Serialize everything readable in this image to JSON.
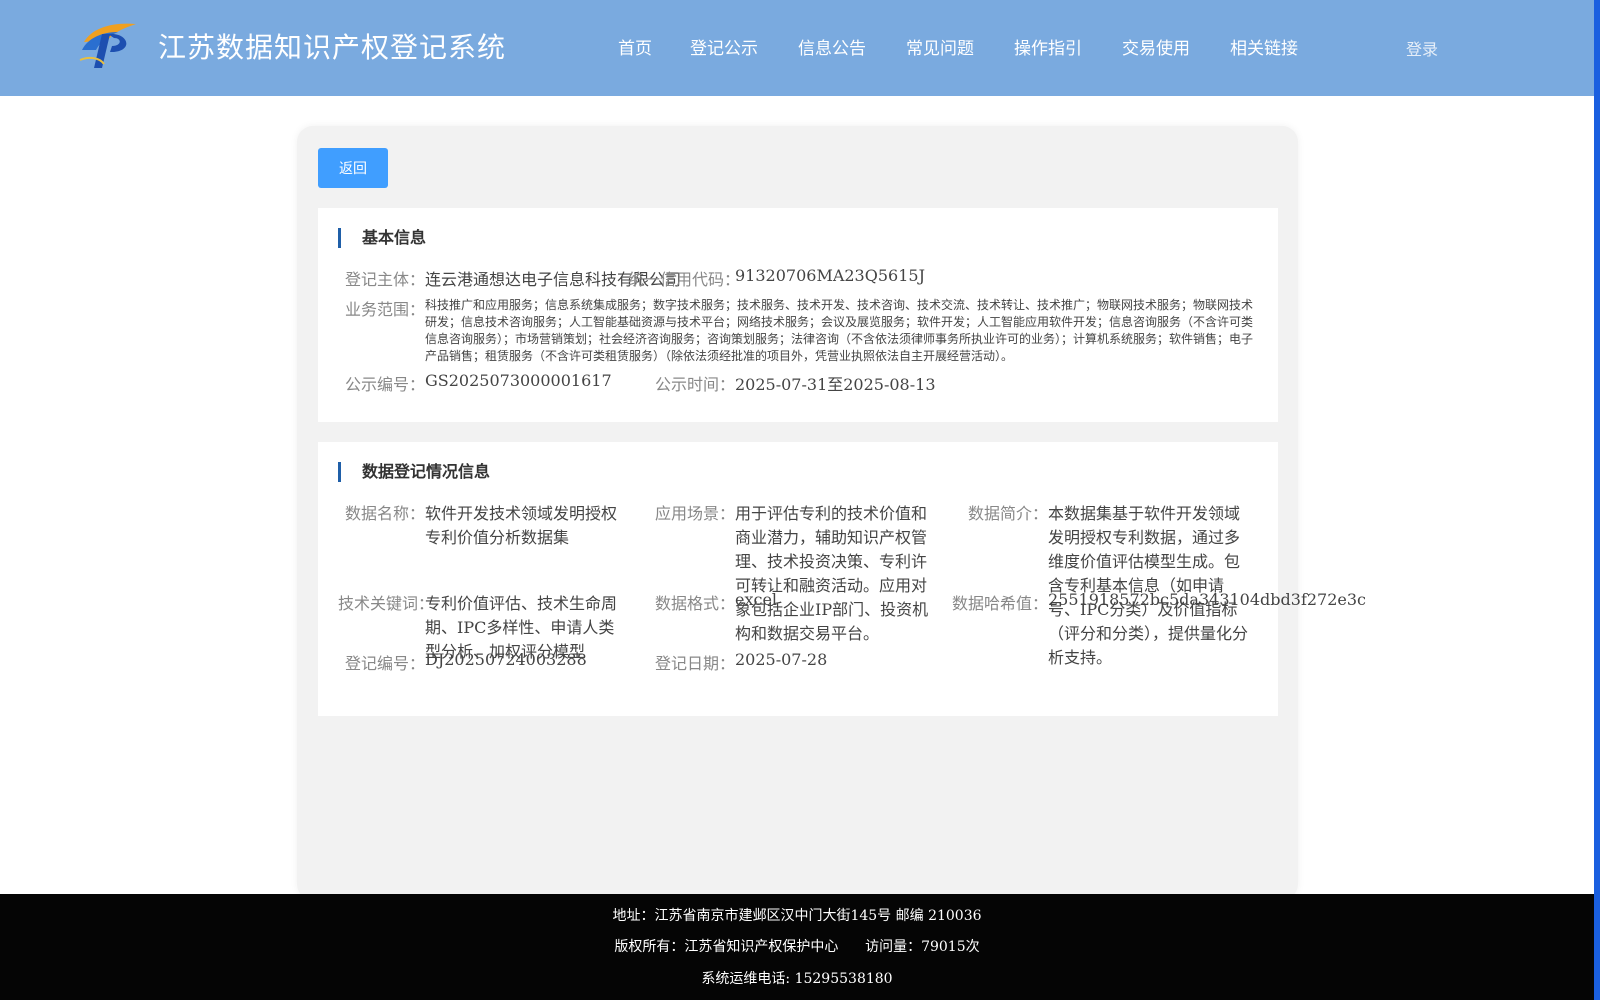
{
  "header": {
    "title": "江苏数据知识产权登记系统",
    "nav": [
      "首页",
      "登记公示",
      "信息公告",
      "常见问题",
      "操作指引",
      "交易使用",
      "相关链接"
    ],
    "login": "登录",
    "logo_icon": "ip-logo-icon",
    "bg_color": "#7aaadf"
  },
  "card": {
    "back_label": "返回",
    "basic": {
      "title": "基本信息",
      "subject_label": "登记主体：",
      "subject_value": "连云港通想达电子信息科技有限公司",
      "credit_label": "统一信用代码：",
      "credit_value": "91320706MA23Q5615J",
      "scope_label": "业务范围：",
      "scope_value": "科技推广和应用服务；信息系统集成服务；数字技术服务；技术服务、技术开发、技术咨询、技术交流、技术转让、技术推广；物联网技术服务；物联网技术研发；信息技术咨询服务；人工智能基础资源与技术平台；网络技术服务；会议及展览服务；软件开发；人工智能应用软件开发；信息咨询服务（不含许可类信息咨询服务）；市场营销策划；社会经济咨询服务；咨询策划服务；法律咨询（不含依法须律师事务所执业许可的业务）；计算机系统服务；软件销售；电子产品销售；租赁服务（不含许可类租赁服务）（除依法须经批准的项目外，凭营业执照依法自主开展经营活动）。",
      "pubno_label": "公示编号：",
      "pubno_value": "GS2025073000001617",
      "pubtime_label": "公示时间：",
      "pubtime_value": "2025-07-31至2025-08-13"
    },
    "data": {
      "title": "数据登记情况信息",
      "name_label": "数据名称：",
      "name_value": "软件开发技术领域发明授权专利价值分析数据集",
      "scene_label": "应用场景：",
      "scene_value": "用于评估专利的技术价值和商业潜力，辅助知识产权管理、技术投资决策、专利许可转让和融资活动。应用对象包括企业IP部门、投资机构和数据交易平台。",
      "intro_label": "数据简介：",
      "intro_value": "本数据集基于软件开发领域发明授权专利数据，通过多维度价值评估模型生成。包含专利基本信息（如申请号、IPC分类）及价值指标（评分和分类），提供量化分析支持。",
      "keyword_label": "技术关键词：",
      "keyword_value": "专利价值评估、技术生命周期、IPC多样性、申请人类型分析、加权评分模型",
      "format_label": "数据格式：",
      "format_value": "excel",
      "hash_label": "数据哈希值：",
      "hash_value": "2551918572bc5da343104dbd3f272e3c",
      "regno_label": "登记编号：",
      "regno_value": "DJ20250724003288",
      "regdate_label": "登记日期：",
      "regdate_value": "2025-07-28"
    }
  },
  "footer": {
    "address": "地址：江苏省南京市建邺区汉中门大街145号 邮编 210036",
    "copyright": "版权所有：江苏省知识产权保护中心      访问量：79015次",
    "phone": "系统运维电话: 15295538180"
  }
}
